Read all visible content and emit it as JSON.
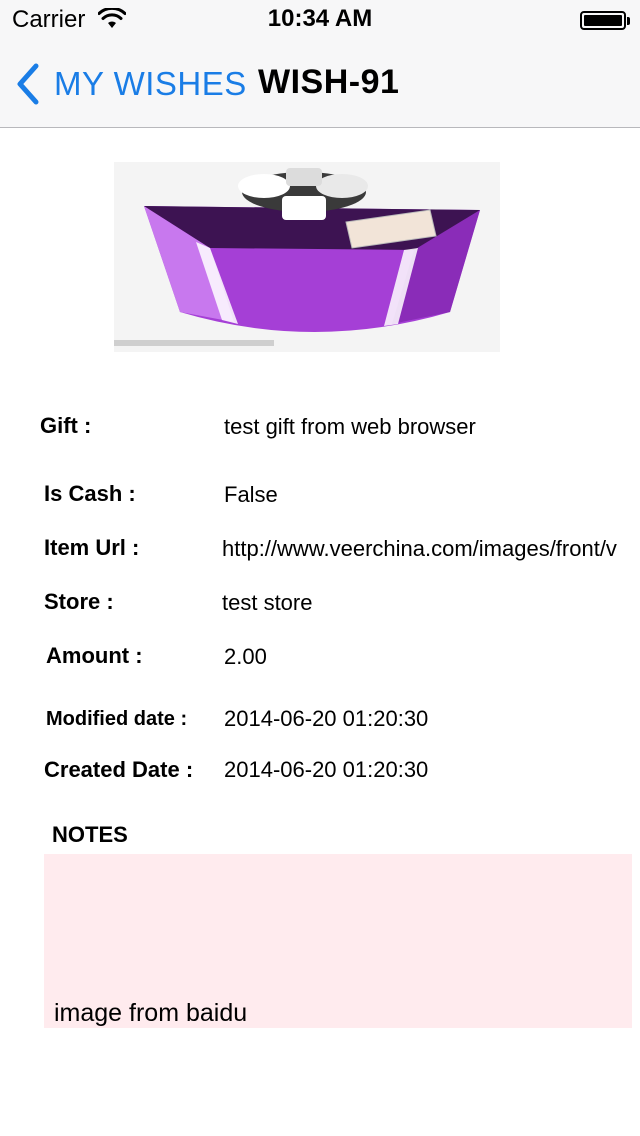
{
  "status_bar": {
    "carrier": "Carrier",
    "time": "10:34 AM"
  },
  "nav": {
    "back_label": "MY WISHES",
    "title": "WISH-91"
  },
  "details": {
    "gift_label": "Gift :",
    "gift_value": "test gift from web browser",
    "is_cash_label": "Is Cash :",
    "is_cash_value": "False",
    "item_url_label": "Item Url :",
    "item_url_value": "http://www.veerchina.com/images/front/v",
    "store_label": "Store :",
    "store_value": "test store",
    "amount_label": "Amount :",
    "amount_value": "2.00",
    "modified_label": "Modified date :",
    "modified_value": "2014-06-20 01:20:30",
    "created_label": "Created Date :",
    "created_value": "2014-06-20 01:20:30"
  },
  "notes": {
    "title": "NOTES",
    "text": "image from baidu"
  },
  "colors": {
    "accent": "#1a7de6",
    "notes_background": "#ffebee",
    "gift_box": "#a53fd6"
  }
}
